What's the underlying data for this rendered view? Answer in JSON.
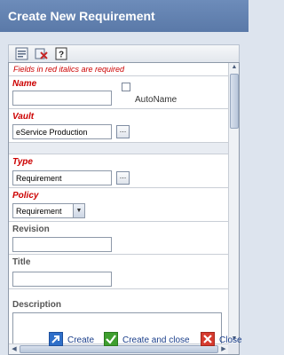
{
  "dialog": {
    "title": "Create New Requirement"
  },
  "toolbar": {
    "icons": [
      "clear-form-icon",
      "reset-icon",
      "help-icon"
    ]
  },
  "form": {
    "note": "Fields in red italics are required",
    "name": {
      "label": "Name",
      "value": "",
      "autoname_label": "AutoName",
      "autoname_checked": false
    },
    "vault": {
      "label": "Vault",
      "value": "eService Production",
      "chooser": "..."
    },
    "type": {
      "label": "Type",
      "value": "Requirement",
      "chooser": "..."
    },
    "policy": {
      "label": "Policy",
      "value": "Requirement"
    },
    "revision": {
      "label": "Revision",
      "value": ""
    },
    "title": {
      "label": "Title",
      "value": ""
    },
    "description": {
      "label": "Description"
    }
  },
  "footer": {
    "create": "Create",
    "create_and_close": "Create and close",
    "close": "Close"
  },
  "colors": {
    "required": "#cc0000",
    "link": "#1b3f8b",
    "title_bar": "#5f7fae"
  }
}
